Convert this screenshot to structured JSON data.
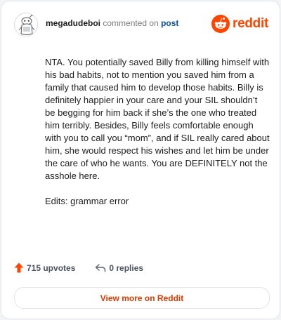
{
  "header": {
    "username": "megadudeboi",
    "action": "commented on",
    "target": "post",
    "brand": "reddit"
  },
  "comment": {
    "body": "NTA. You potentially saved Billy from killing himself with his bad habits, not to mention you saved him from a family that caused him to develop those habits. Billy is definitely happier in your care and your SIL shouldn’t be begging for him back if she’s the one who treated him terribly. Besides, Billy feels comfortable enough with you to call you “mom”, and if SIL really cared about him, she would respect his wishes and let him be under the care of who he wants. You are DEFINITELY not the asshole here.",
    "edit_note": "Edits: grammar error"
  },
  "footer": {
    "upvotes": "715 upvotes",
    "replies": "0 replies"
  },
  "cta": {
    "label": "View more on Reddit"
  },
  "colors": {
    "brand_orange": "#ff4500",
    "link_blue": "#0b4f9c",
    "cta_text": "#d93a00"
  },
  "icons": [
    "avatar-snoo",
    "reddit-snoo-icon",
    "upvote-arrow-icon",
    "reply-arrow-icon"
  ]
}
